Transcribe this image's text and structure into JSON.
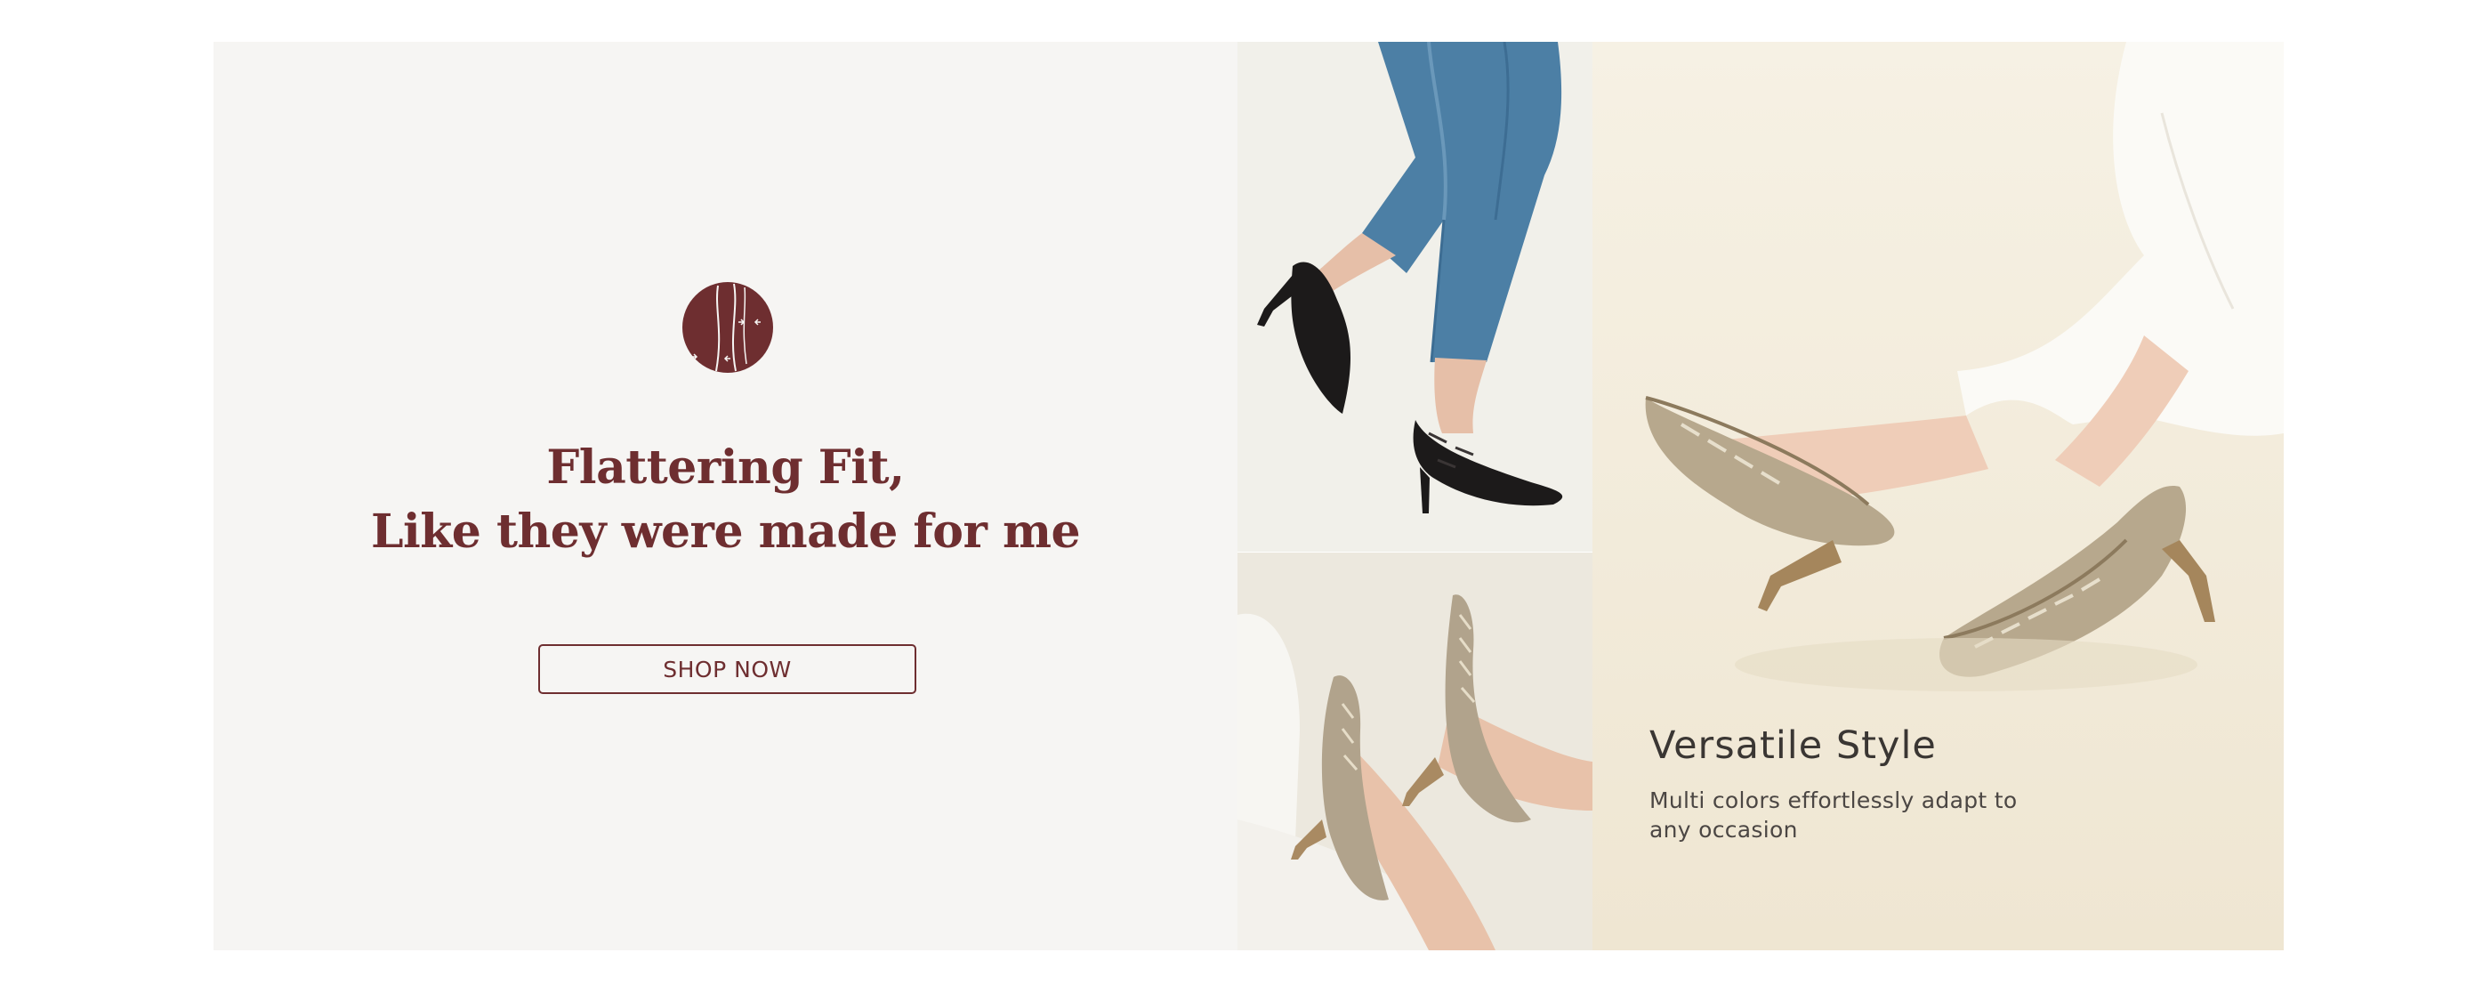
{
  "promo": {
    "headline_line1": "Flattering Fit,",
    "headline_line2": "Like they were made for me",
    "cta_label": "SHOP NOW",
    "icon": "fitted-leg-icon",
    "accent_color": "#6e2e30",
    "panel_background": "#f6f5f3"
  },
  "feature": {
    "title": "Versatile Style",
    "description": "Multi colors effortlessly adapt to any occasion"
  },
  "photos": [
    {
      "icon": "black-pumps-jeans-photo"
    },
    {
      "icon": "beige-pumps-pair-photo"
    },
    {
      "icon": "beige-pumps-lifestyle-photo"
    }
  ]
}
